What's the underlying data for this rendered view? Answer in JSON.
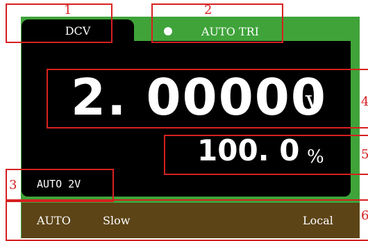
{
  "display": {
    "mode_tab": "DCV",
    "trigger_label": "AUTO TRI",
    "reading": "2. 00000",
    "reading_unit": "V",
    "percent": "100. 0",
    "percent_unit": "%",
    "range": "AUTO 2V"
  },
  "status_bar": {
    "left": "AUTO",
    "speed": "Slow",
    "remote": "Local"
  },
  "callouts": [
    "1",
    "2",
    "3",
    "4",
    "5",
    "6"
  ],
  "colors": {
    "frame_green": "#3fa33a",
    "screen_black": "#000000",
    "status_brown": "#5c4417",
    "callout_red": "#d62020"
  },
  "icons": {
    "trigger_indicator": "dot-icon"
  }
}
